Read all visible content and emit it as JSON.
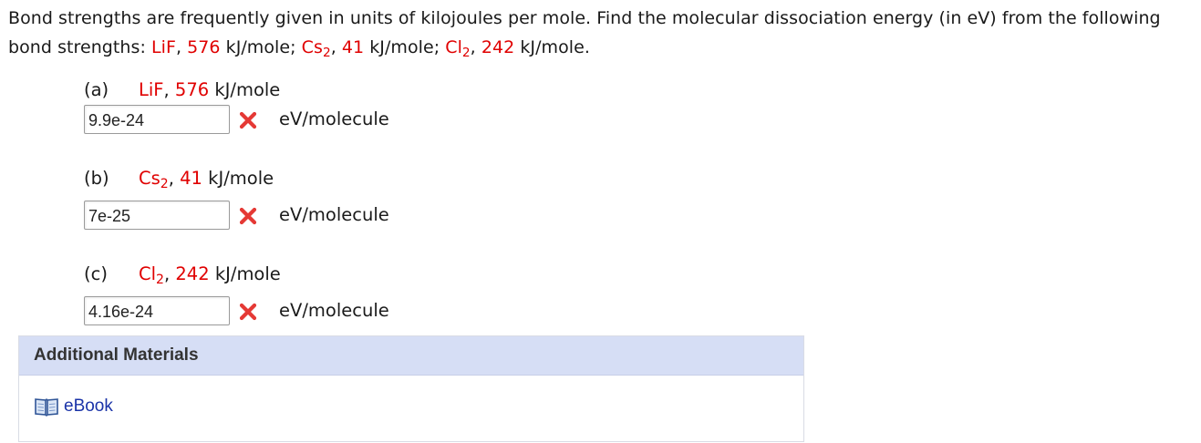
{
  "question": {
    "intro": "Bond strengths are frequently given in units of kilojoules per mole. Find the molecular dissociation energy (in eV) from the following bond strengths: ",
    "items": [
      {
        "molecule": "LiF",
        "molecule_sub": "",
        "value": "576",
        "unit": " kJ/mole",
        "sep": "; "
      },
      {
        "molecule": "Cs",
        "molecule_sub": "2",
        "value": "41",
        "unit": " kJ/mole",
        "sep": "; "
      },
      {
        "molecule": "Cl",
        "molecule_sub": "2",
        "value": "242",
        "unit": " kJ/mole",
        "sep": "."
      }
    ]
  },
  "parts": [
    {
      "letter": "(a)",
      "molecule": "LiF",
      "molecule_sub": "",
      "value": "576",
      "unit_label": "kJ/mole",
      "answer": "9.9e-24",
      "status": "incorrect",
      "answer_unit": "eV/molecule"
    },
    {
      "letter": "(b)",
      "molecule": "Cs",
      "molecule_sub": "2",
      "value": "41",
      "unit_label": "kJ/mole",
      "answer": "7e-25",
      "status": "incorrect",
      "answer_unit": "eV/molecule"
    },
    {
      "letter": "(c)",
      "molecule": "Cl",
      "molecule_sub": "2",
      "value": "242",
      "unit_label": "kJ/mole",
      "answer": "4.16e-24",
      "status": "incorrect",
      "answer_unit": "eV/molecule"
    }
  ],
  "materials": {
    "header": "Additional Materials",
    "ebook_label": "eBook"
  },
  "icons": {
    "incorrect": "x-mark-icon",
    "ebook": "book-icon"
  },
  "colors": {
    "highlight": "#e00000",
    "incorrect": "#e53935",
    "link": "#1a33a8",
    "materials_header_bg": "#d6def5"
  }
}
